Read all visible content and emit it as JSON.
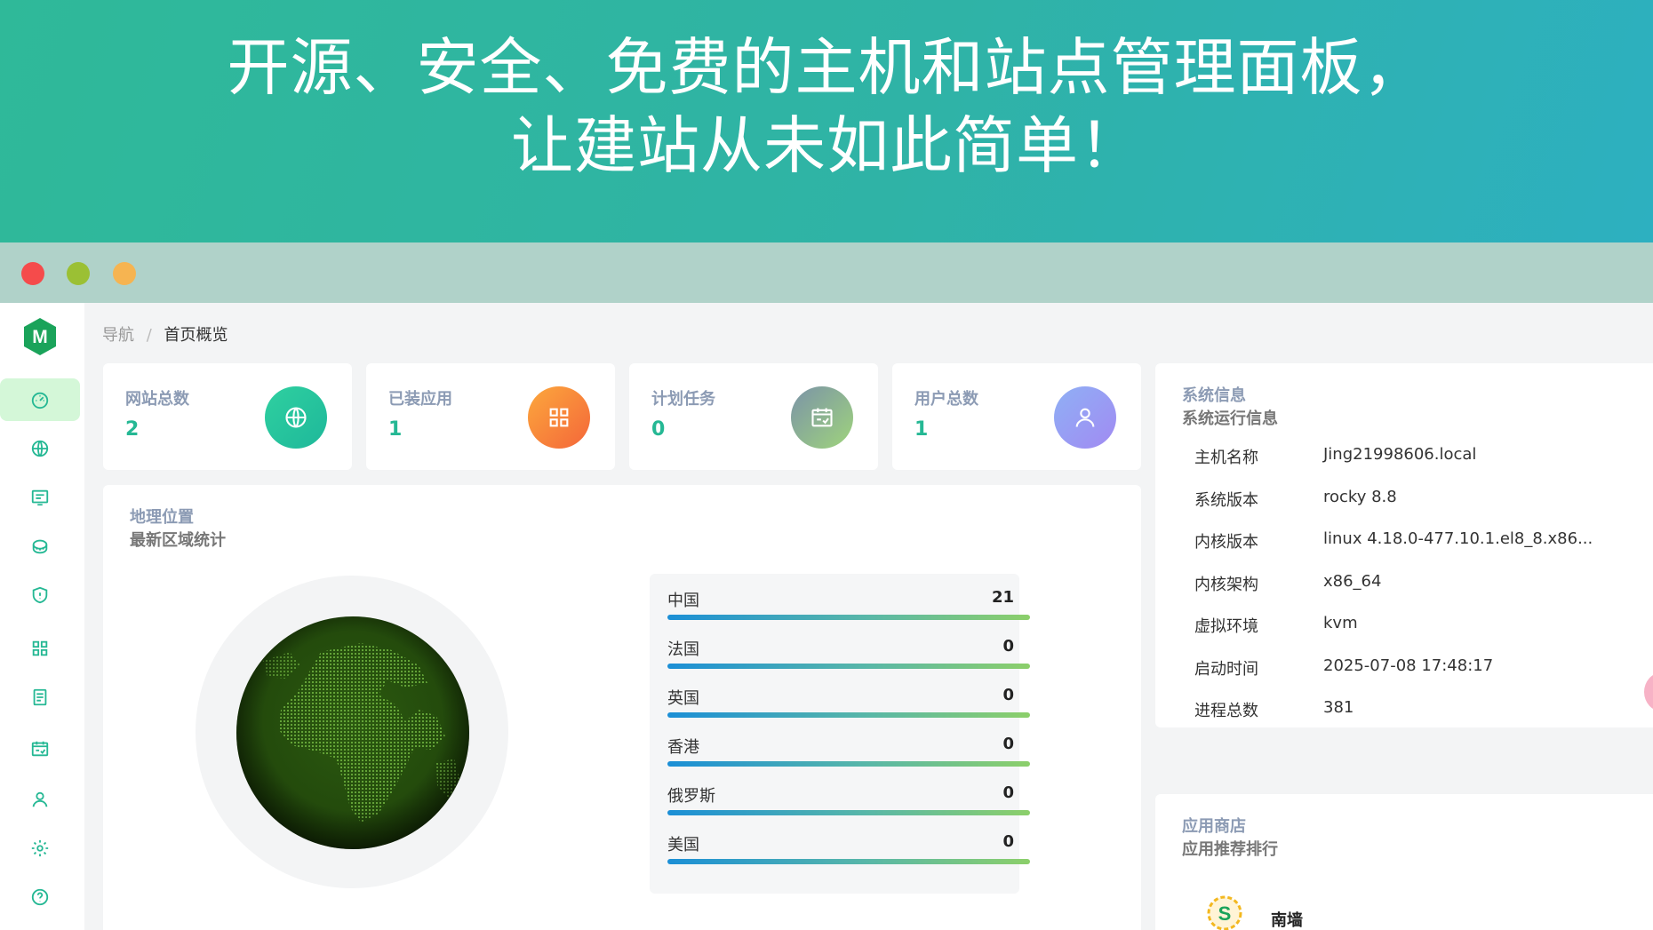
{
  "hero": {
    "line1": "开源、安全、免费的主机和站点管理面板，",
    "line2": "让建站从未如此简单！"
  },
  "colors": {
    "accent": "#25b894",
    "active_nav_bg": "#d4f7d8",
    "hero_gradient": [
      "#2fb999",
      "#2db0c0"
    ]
  },
  "breadcrumb": {
    "root": "导航",
    "separator": "/",
    "current": "首页概览"
  },
  "sidebar": {
    "items": [
      {
        "icon": "dashboard-icon",
        "active": true
      },
      {
        "icon": "globe-icon"
      },
      {
        "icon": "website-icon"
      },
      {
        "icon": "database-icon"
      },
      {
        "icon": "shield-icon"
      },
      {
        "icon": "apps-icon"
      },
      {
        "icon": "file-icon"
      },
      {
        "icon": "calendar-icon"
      },
      {
        "icon": "user-icon"
      },
      {
        "icon": "gear-icon"
      },
      {
        "icon": "help-icon"
      }
    ]
  },
  "stats": [
    {
      "label": "网站总数",
      "value": "2",
      "icon": "globe-icon"
    },
    {
      "label": "已装应用",
      "value": "1",
      "icon": "apps-icon"
    },
    {
      "label": "计划任务",
      "value": "0",
      "icon": "calendar-icon"
    },
    {
      "label": "用户总数",
      "value": "1",
      "icon": "user-icon"
    }
  ],
  "geo": {
    "title": "地理位置",
    "subtitle": "最新区域统计",
    "regions": [
      {
        "name": "中国",
        "count": "21"
      },
      {
        "name": "法国",
        "count": "0"
      },
      {
        "name": "英国",
        "count": "0"
      },
      {
        "name": "香港",
        "count": "0"
      },
      {
        "name": "俄罗斯",
        "count": "0"
      },
      {
        "name": "美国",
        "count": "0"
      }
    ]
  },
  "sysinfo": {
    "title": "系统信息",
    "subtitle": "系统运行信息",
    "rows": [
      {
        "key": "主机名称",
        "value": "Jing21998606.local"
      },
      {
        "key": "系统版本",
        "value": "rocky 8.8"
      },
      {
        "key": "内核版本",
        "value": "linux 4.18.0-477.10.1.el8_8.x86..."
      },
      {
        "key": "内核架构",
        "value": "x86_64"
      },
      {
        "key": "虚拟环境",
        "value": "kvm"
      },
      {
        "key": "启动时间",
        "value": "2025-07-08 17:48:17"
      },
      {
        "key": "进程总数",
        "value": "381"
      }
    ]
  },
  "appstore": {
    "title": "应用商店",
    "subtitle": "应用推荐排行",
    "first_app": {
      "name": "南墙",
      "icon": "nanqiang-logo"
    }
  }
}
